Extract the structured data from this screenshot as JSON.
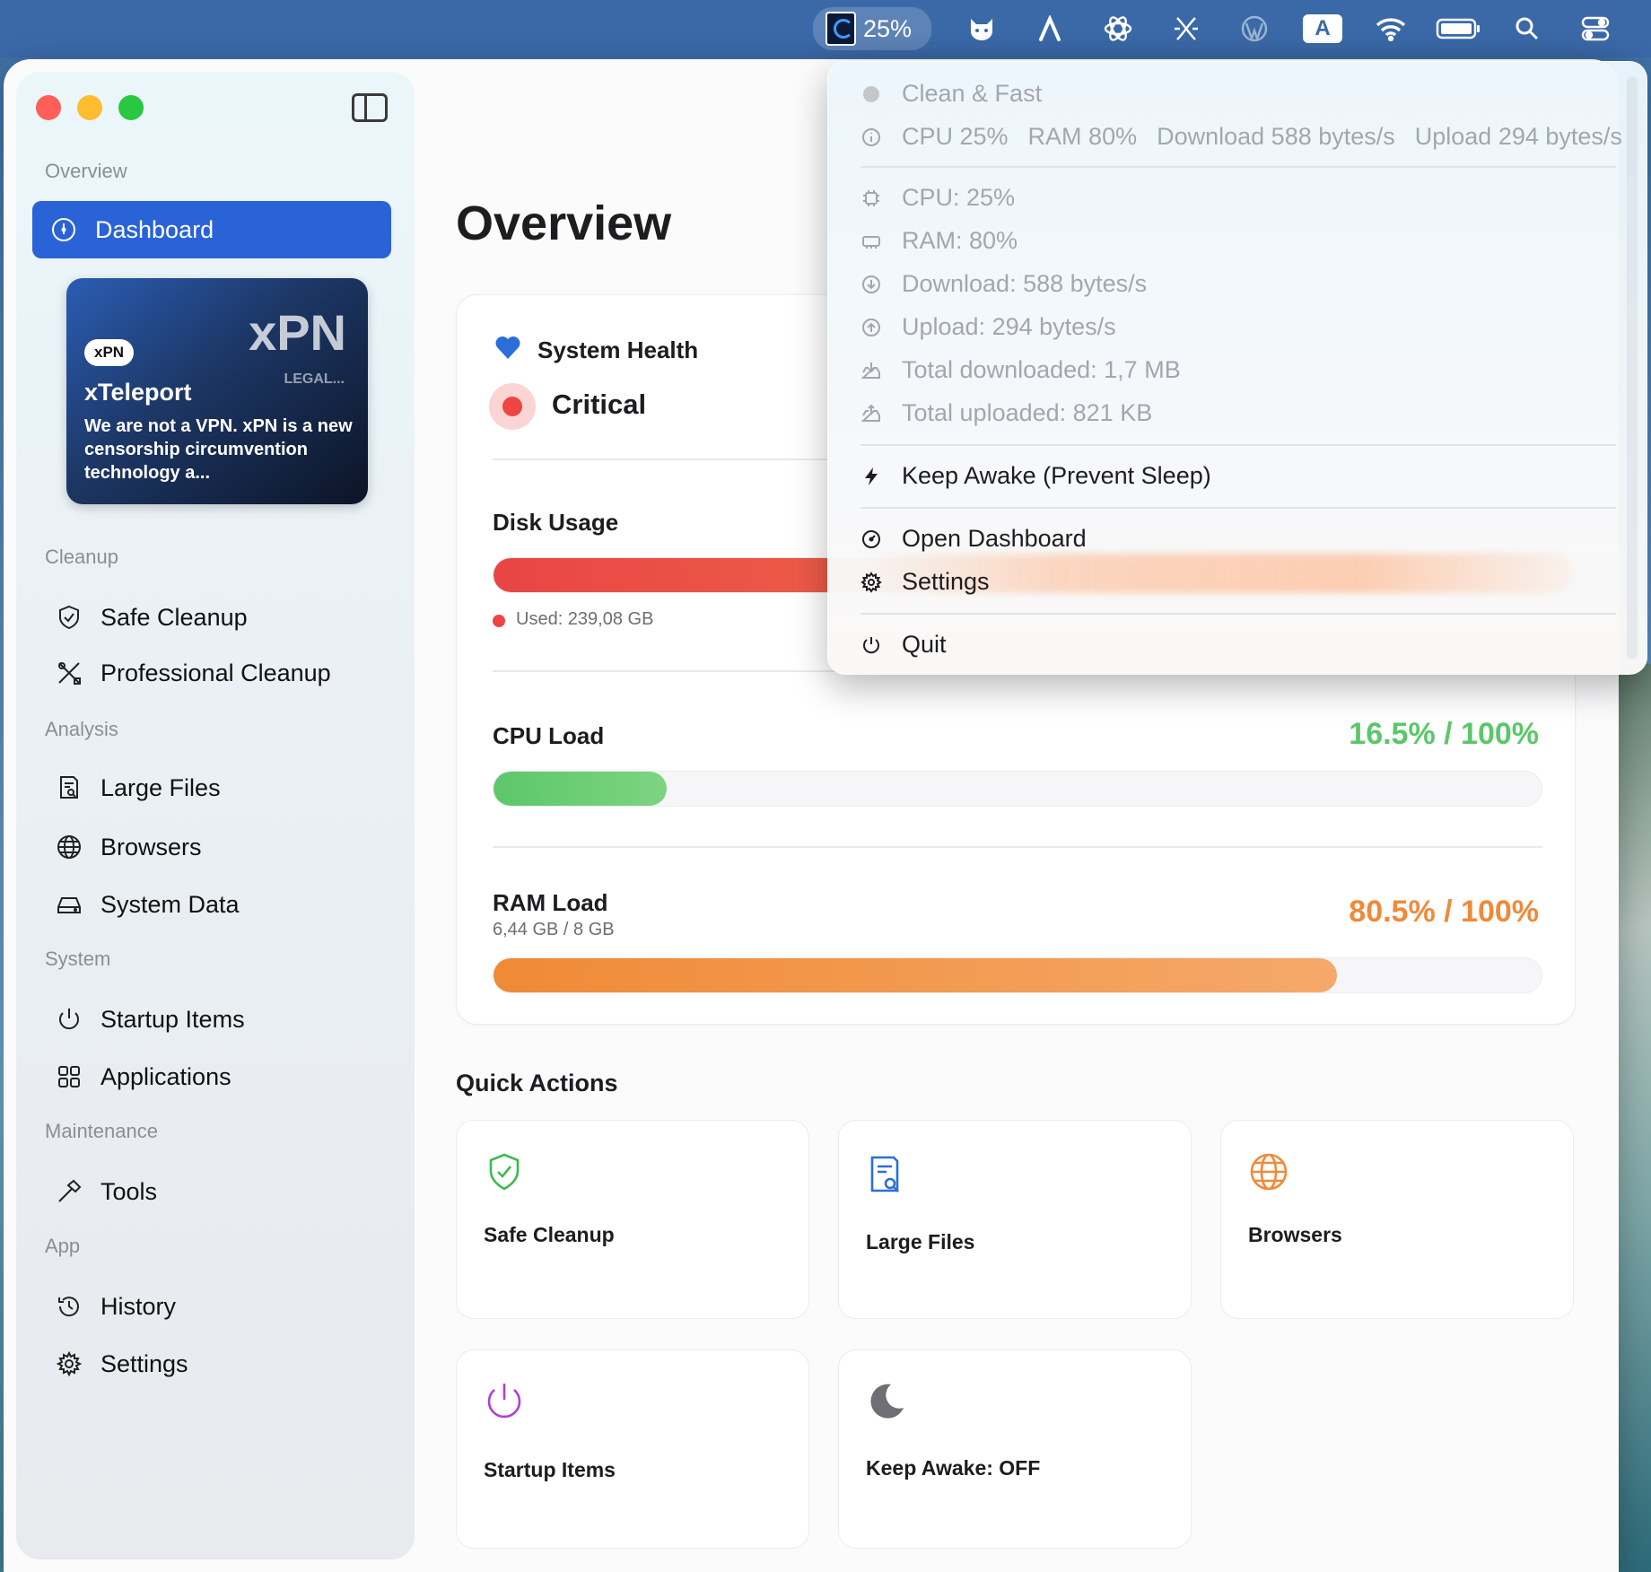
{
  "menubar": {
    "app_percent": "25%",
    "a_badge": "A",
    "icons": [
      "app-logo-icon",
      "cat-icon",
      "font-a-icon",
      "openai-icon",
      "x-logo-icon",
      "wordpress-icon",
      "keyboard-a-icon",
      "wifi-icon",
      "battery-icon",
      "search-icon",
      "control-center-icon"
    ]
  },
  "sidebar": {
    "sections": {
      "overview": "Overview",
      "cleanup": "Cleanup",
      "analysis": "Analysis",
      "system": "System",
      "maintenance": "Maintenance",
      "app": "App"
    },
    "items": {
      "dashboard": "Dashboard",
      "safe_cleanup": "Safe Cleanup",
      "professional_cleanup": "Professional Cleanup",
      "large_files": "Large Files",
      "browsers": "Browsers",
      "system_data": "System Data",
      "startup_items": "Startup Items",
      "applications": "Applications",
      "tools": "Tools",
      "history": "History",
      "settings": "Settings"
    },
    "promo": {
      "big_logo": "xPN",
      "legal": "LEGAL...",
      "pill": "xPN",
      "title": "xTeleport",
      "desc": "We are not a VPN. xPN is a new censorship circumvention technology a..."
    }
  },
  "main": {
    "title": "Overview",
    "health": {
      "label": "System Health",
      "status": "Critical"
    },
    "disk": {
      "label": "Disk Usage",
      "used": "Used: 239,08 GB",
      "fill": 0.55
    },
    "cpu": {
      "label": "CPU Load",
      "value": "16.5% / 100%",
      "fill": 0.165
    },
    "ram": {
      "label": "RAM Load",
      "sub": "6,44 GB / 8 GB",
      "value": "80.5% / 100%",
      "fill": 0.805
    },
    "quick_actions": {
      "title": "Quick Actions",
      "items": [
        "Safe Cleanup",
        "Large Files",
        "Browsers",
        "Startup Items",
        "Keep Awake: OFF"
      ]
    }
  },
  "menu": {
    "header": "Clean & Fast",
    "summary": {
      "cpu": "CPU 25%",
      "ram": "RAM 80%",
      "download": "Download 588 bytes/s",
      "upload": "Upload 294 bytes/s"
    },
    "stats": {
      "cpu": "CPU: 25%",
      "ram": "RAM: 80%",
      "download": "Download: 588 bytes/s",
      "upload": "Upload: 294 bytes/s",
      "total_down": "Total downloaded: 1,7 MB",
      "total_up": "Total uploaded: 821 KB"
    },
    "keep_awake": "Keep Awake (Prevent Sleep)",
    "open_dashboard": "Open Dashboard",
    "settings": "Settings",
    "quit": "Quit"
  },
  "colors": {
    "accent": "#2a63d8",
    "critical": "#ef4444",
    "cpu_green": "#5cc76a",
    "ram_orange": "#f08a3a",
    "safe_green": "#3fb950",
    "large_blue": "#2a6fd8",
    "browser_orange": "#f08a3a",
    "startup_purple": "#b33dd6",
    "moon_gray": "#6e6e73"
  }
}
